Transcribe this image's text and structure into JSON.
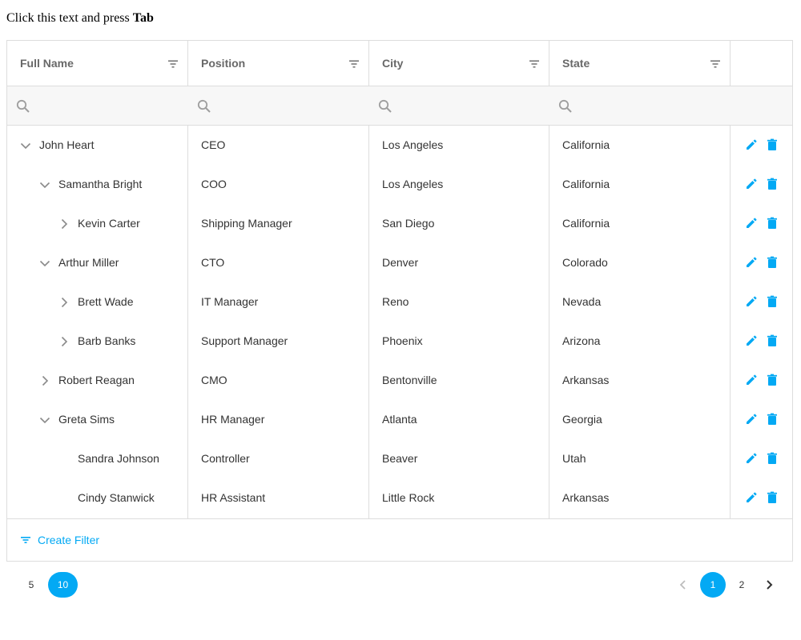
{
  "intro": {
    "prefix": "Click this text and press ",
    "key": "Tab"
  },
  "colors": {
    "accent": "#03a9f4",
    "border": "#dddddd",
    "header_text": "#686868",
    "filter_bg": "#f7f7f7"
  },
  "columns": [
    {
      "label": "Full Name",
      "icon": "filter-icon"
    },
    {
      "label": "Position",
      "icon": "filter-icon"
    },
    {
      "label": "City",
      "icon": "filter-icon"
    },
    {
      "label": "State",
      "icon": "filter-icon"
    }
  ],
  "filter_row": {
    "icon": "search-icon"
  },
  "rows": [
    {
      "name": "John Heart",
      "position": "CEO",
      "city": "Los Angeles",
      "state": "California",
      "level": 0,
      "toggle": "expanded"
    },
    {
      "name": "Samantha Bright",
      "position": "COO",
      "city": "Los Angeles",
      "state": "California",
      "level": 1,
      "toggle": "expanded"
    },
    {
      "name": "Kevin Carter",
      "position": "Shipping Manager",
      "city": "San Diego",
      "state": "California",
      "level": 2,
      "toggle": "collapsed"
    },
    {
      "name": "Arthur Miller",
      "position": "CTO",
      "city": "Denver",
      "state": "Colorado",
      "level": 1,
      "toggle": "expanded"
    },
    {
      "name": "Brett Wade",
      "position": "IT Manager",
      "city": "Reno",
      "state": "Nevada",
      "level": 2,
      "toggle": "collapsed"
    },
    {
      "name": "Barb Banks",
      "position": "Support Manager",
      "city": "Phoenix",
      "state": "Arizona",
      "level": 2,
      "toggle": "collapsed"
    },
    {
      "name": "Robert Reagan",
      "position": "CMO",
      "city": "Bentonville",
      "state": "Arkansas",
      "level": 1,
      "toggle": "collapsed"
    },
    {
      "name": "Greta Sims",
      "position": "HR Manager",
      "city": "Atlanta",
      "state": "Georgia",
      "level": 1,
      "toggle": "expanded"
    },
    {
      "name": "Sandra Johnson",
      "position": "Controller",
      "city": "Beaver",
      "state": "Utah",
      "level": 2,
      "toggle": "none"
    },
    {
      "name": "Cindy Stanwick",
      "position": "HR Assistant",
      "city": "Little Rock",
      "state": "Arkansas",
      "level": 2,
      "toggle": "none"
    }
  ],
  "row_actions": {
    "edit_icon": "pencil-icon",
    "delete_icon": "trash-icon"
  },
  "footer": {
    "create_filter_label": "Create Filter",
    "icon": "filter-icon"
  },
  "pager": {
    "page_sizes": [
      "5",
      "10"
    ],
    "selected_page_size": "10",
    "pages": [
      "1",
      "2"
    ],
    "current_page": "1",
    "prev_icon": "chevron-left-icon",
    "next_icon": "chevron-right-icon"
  }
}
